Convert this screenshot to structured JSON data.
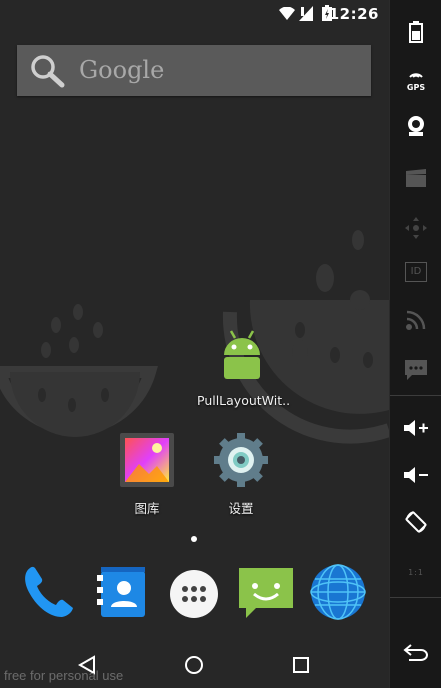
{
  "status_bar": {
    "time": "12:26",
    "icons": [
      "wifi-icon",
      "signal-icon",
      "battery-icon"
    ]
  },
  "search": {
    "logo_text": "Google",
    "icon": "search-icon"
  },
  "home": {
    "apps": [
      {
        "label": "PullLayoutWit..",
        "icon": "android-app-icon"
      },
      {
        "label": "图库",
        "icon": "gallery-icon"
      },
      {
        "label": "设置",
        "icon": "settings-gear-icon"
      }
    ],
    "page_indicator": {
      "pages": 1,
      "current": 1
    }
  },
  "dock": {
    "items": [
      {
        "name": "phone",
        "icon": "phone-icon"
      },
      {
        "name": "contacts",
        "icon": "contacts-icon"
      },
      {
        "name": "all-apps",
        "icon": "app-drawer-icon"
      },
      {
        "name": "messaging",
        "icon": "messaging-icon"
      },
      {
        "name": "browser",
        "icon": "globe-icon"
      }
    ]
  },
  "nav_bar": {
    "buttons": [
      "back-icon",
      "home-icon",
      "recents-icon"
    ]
  },
  "emulator_toolbar": {
    "items": [
      {
        "name": "battery",
        "label": ""
      },
      {
        "name": "gps",
        "label": "GPS"
      },
      {
        "name": "camera",
        "label": ""
      },
      {
        "name": "media",
        "label": ""
      },
      {
        "name": "dpad",
        "label": ""
      },
      {
        "name": "device-id",
        "label": "ID"
      },
      {
        "name": "network",
        "label": ""
      },
      {
        "name": "sms",
        "label": ""
      },
      {
        "name": "volume-up",
        "label": ""
      },
      {
        "name": "volume-down",
        "label": ""
      },
      {
        "name": "rotate",
        "label": ""
      },
      {
        "name": "scale",
        "label": "1:1"
      },
      {
        "name": "back",
        "label": ""
      }
    ]
  },
  "watermark": "free for personal use",
  "colors": {
    "wallpaper": "#272727",
    "search_bar": "#5a5a5a",
    "android_green": "#8bc34a",
    "dock_blue": "#1e88e5"
  }
}
